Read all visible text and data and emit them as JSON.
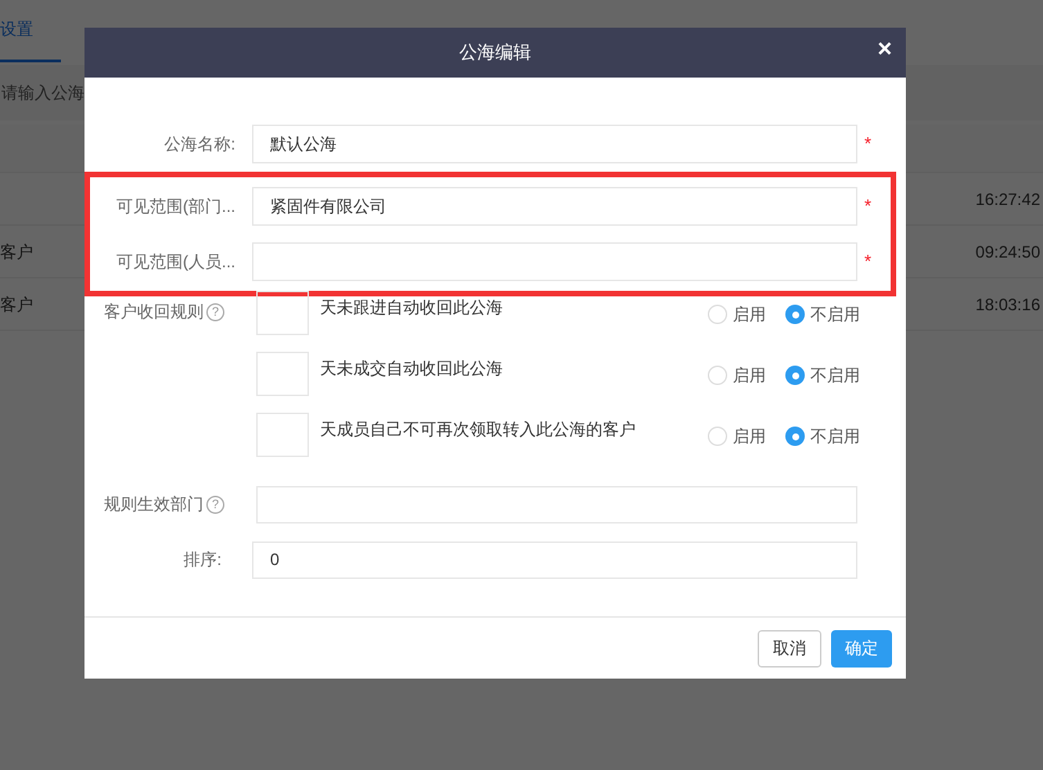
{
  "background_page": {
    "tab": {
      "label": "设置",
      "selected": true
    },
    "search": {
      "placeholder": "请输入公海"
    },
    "rows": [
      {
        "name": "",
        "time": "16:27:42"
      },
      {
        "name": "客户",
        "time": "09:24:50"
      },
      {
        "name": "客户",
        "time": "18:03:16"
      }
    ]
  },
  "dialog": {
    "title": "公海编辑",
    "close": "×",
    "fields": [
      {
        "label": "公海名称:",
        "value": "默认公海",
        "required_mark": "*"
      }
    ],
    "outlined_group": {
      "outlined": true,
      "fields": [
        {
          "label": "可见范围(部门...",
          "value": "紧固件有限公司",
          "required_mark": "*"
        },
        {
          "label": "可见范围(人员...",
          "required_mark": "*"
        }
      ]
    },
    "rules": {
      "label": "客户收回规则",
      "help": "?",
      "items": [
        {
          "text": "天未跟进自动收回此公海",
          "options": [
            {
              "label": "启用",
              "selected": false
            },
            {
              "label": "不启用",
              "selected": true
            }
          ]
        },
        {
          "text": "天未成交自动收回此公海",
          "options": [
            {
              "label": "启用",
              "selected": false
            },
            {
              "label": "不启用",
              "selected": true
            }
          ]
        },
        {
          "text": "天成员自己不可再次领取转入此公海的客户",
          "options": [
            {
              "label": "启用",
              "selected": false
            },
            {
              "label": "不启用",
              "selected": true
            }
          ]
        }
      ]
    },
    "dept": {
      "label": "规则生效部门",
      "help": "?"
    },
    "sort": {
      "label": "排序:",
      "value": "0"
    },
    "buttons": [
      {
        "label": "取消",
        "kind": "secondary"
      },
      {
        "label": "确定",
        "kind": "primary"
      }
    ]
  }
}
